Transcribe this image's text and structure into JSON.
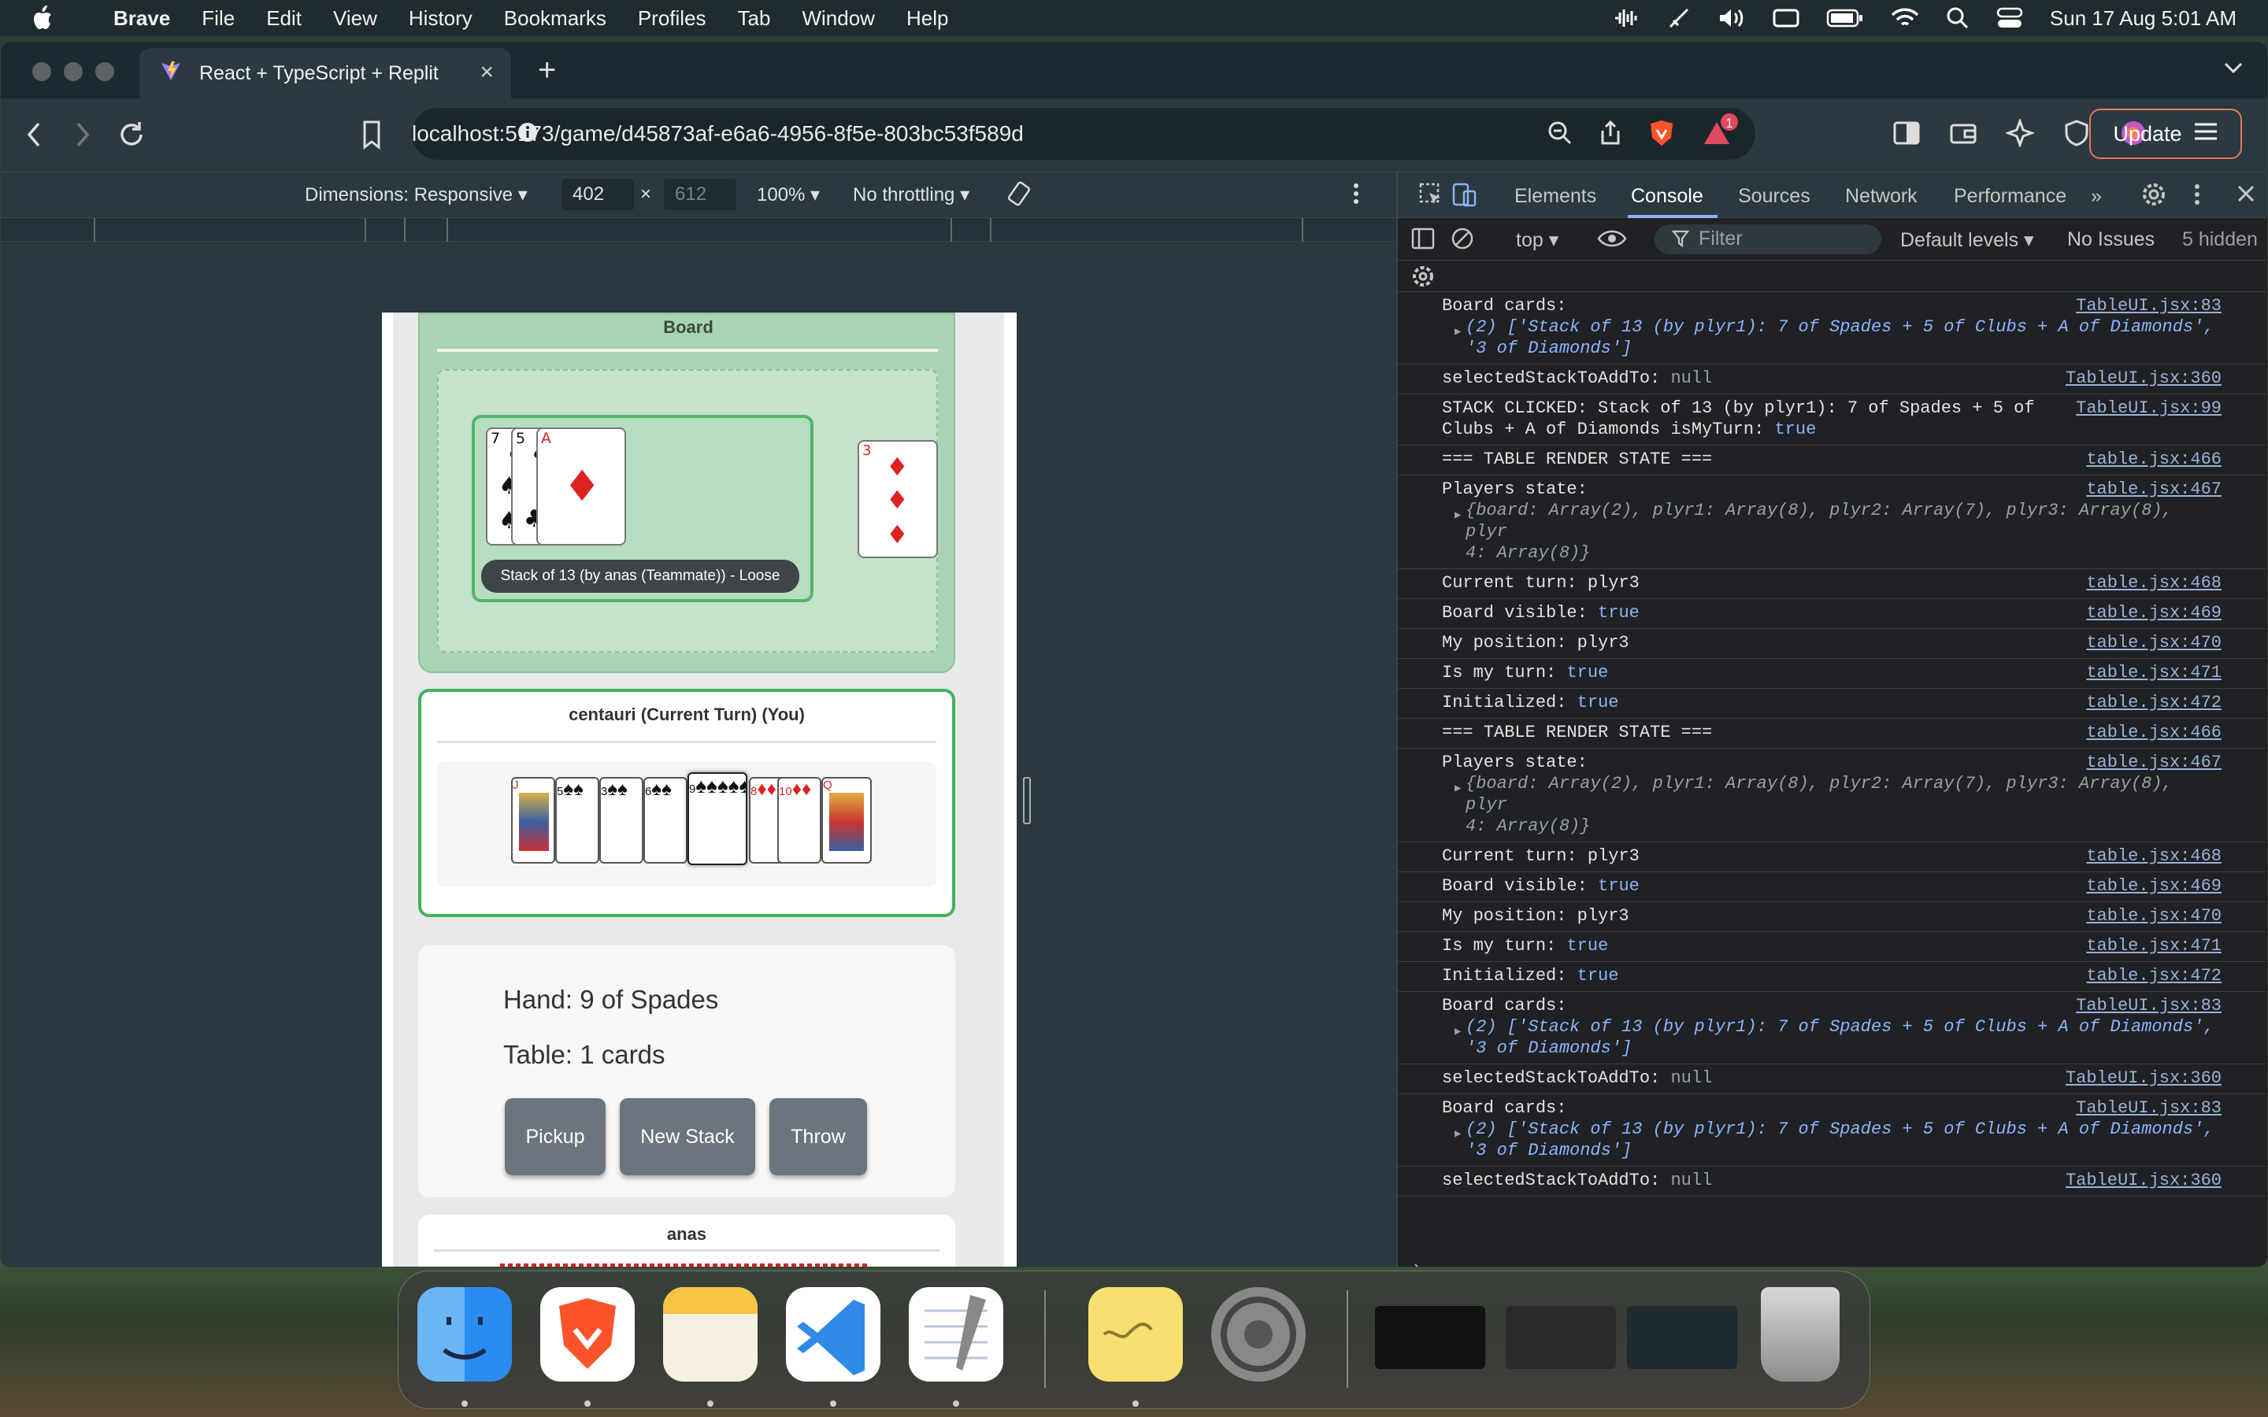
{
  "menubar": {
    "app": "Brave",
    "items": [
      "File",
      "Edit",
      "View",
      "History",
      "Bookmarks",
      "Profiles",
      "Tab",
      "Window",
      "Help"
    ],
    "datetime": "Sun 17 Aug  5:01 AM"
  },
  "browser": {
    "tab_title": "React + TypeScript + Replit",
    "url": "localhost:5173/game/d45873af-e6a6-4956-8f5e-803bc53f589d",
    "update_label": "Update",
    "notification_count": "1"
  },
  "device_toolbar": {
    "dimensions": "Dimensions: Responsive",
    "width": "402",
    "height": "612",
    "zoom": "100%",
    "throttling": "No throttling"
  },
  "game": {
    "board_title": "Board",
    "stack": {
      "cards": [
        {
          "rank": "7",
          "suit": "♠",
          "color": "black"
        },
        {
          "rank": "5",
          "suit": "♣",
          "color": "black"
        },
        {
          "rank": "A",
          "suit": "♦",
          "color": "red"
        }
      ],
      "label": "Stack of 13 (by anas (Teammate)) - Loose"
    },
    "loose_card": {
      "rank": "3",
      "suit": "♦",
      "color": "red"
    },
    "player_title": "centauri (Current Turn) (You)",
    "hand_cards": [
      {
        "rank": "J",
        "suit": "♣",
        "color": "black",
        "face": true
      },
      {
        "rank": "5",
        "suit": "♠",
        "color": "black"
      },
      {
        "rank": "3",
        "suit": "♠",
        "color": "black"
      },
      {
        "rank": "6",
        "suit": "♠",
        "color": "black"
      },
      {
        "rank": "9",
        "suit": "♠",
        "color": "black",
        "selected": true
      },
      {
        "rank": "8",
        "suit": "♦",
        "color": "red"
      },
      {
        "rank": "10",
        "suit": "♦",
        "color": "red"
      },
      {
        "rank": "Q",
        "suit": "♦",
        "color": "red",
        "face": true
      }
    ],
    "hand_info": "Hand: 9 of Spades",
    "table_info": "Table: 1 cards",
    "buttons": [
      "Pickup",
      "New Stack",
      "Throw"
    ],
    "next_player": "anas"
  },
  "devtools": {
    "tabs": [
      "Elements",
      "Console",
      "Sources",
      "Network",
      "Performance"
    ],
    "active_tab": "Console",
    "context": "top",
    "filter_placeholder": "Filter",
    "levels": "Default levels",
    "issues": "No Issues",
    "hidden": "5 hidden",
    "logs": [
      {
        "text": "Board cards:",
        "sub": "(2) ['Stack of 13 (by plyr1): 7 of Spades + 5 of Clubs + A of Diamonds',",
        "sub2": "'3 of Diamonds']",
        "src": "TableUI.jsx:83"
      },
      {
        "text": "selectedStackToAddTo:",
        "val": "null",
        "null": true,
        "src": "TableUI.jsx:360"
      },
      {
        "text": "STACK CLICKED: Stack of 13 (by plyr1): 7 of Spades + 5 of",
        "text2": "Clubs + A of Diamonds isMyTurn:",
        "val": "true",
        "src": "TableUI.jsx:99"
      },
      {
        "text": "=== TABLE RENDER STATE ===",
        "src": "table.jsx:466"
      },
      {
        "text": "Players state:",
        "sub": "{board: Array(2), plyr1: Array(8), plyr2: Array(7), plyr3: Array(8), plyr",
        "sub2": "4: Array(8)}",
        "src": "table.jsx:467"
      },
      {
        "text": "Current turn: plyr3",
        "src": "table.jsx:468"
      },
      {
        "text": "Board visible:",
        "val": "true",
        "src": "table.jsx:469"
      },
      {
        "text": "My position: plyr3",
        "src": "table.jsx:470"
      },
      {
        "text": "Is my turn:",
        "val": "true",
        "src": "table.jsx:471"
      },
      {
        "text": "Initialized:",
        "val": "true",
        "src": "table.jsx:472"
      },
      {
        "text": "=== TABLE RENDER STATE ===",
        "src": "table.jsx:466"
      },
      {
        "text": "Players state:",
        "sub": "{board: Array(2), plyr1: Array(8), plyr2: Array(7), plyr3: Array(8), plyr",
        "sub2": "4: Array(8)}",
        "src": "table.jsx:467"
      },
      {
        "text": "Current turn: plyr3",
        "src": "table.jsx:468"
      },
      {
        "text": "Board visible:",
        "val": "true",
        "src": "table.jsx:469"
      },
      {
        "text": "My position: plyr3",
        "src": "table.jsx:470"
      },
      {
        "text": "Is my turn:",
        "val": "true",
        "src": "table.jsx:471"
      },
      {
        "text": "Initialized:",
        "val": "true",
        "src": "table.jsx:472"
      },
      {
        "text": "Board cards:",
        "sub": "(2) ['Stack of 13 (by plyr1): 7 of Spades + 5 of Clubs + A of Diamonds',",
        "sub2": "'3 of Diamonds']",
        "src": "TableUI.jsx:83"
      },
      {
        "text": "selectedStackToAddTo:",
        "val": "null",
        "null": true,
        "src": "TableUI.jsx:360"
      },
      {
        "text": "Board cards:",
        "sub": "(2) ['Stack of 13 (by plyr1): 7 of Spades + 5 of Clubs + A of Diamonds',",
        "sub2": "'3 of Diamonds']",
        "src": "TableUI.jsx:83"
      },
      {
        "text": "selectedStackToAddTo:",
        "val": "null",
        "null": true,
        "src": "TableUI.jsx:360"
      }
    ]
  },
  "dock": {
    "apps": [
      "finder-icon",
      "brave-icon",
      "notes-icon",
      "vscode-icon",
      "textedit-icon",
      "stickies-icon",
      "settings-icon",
      "trash-icon"
    ]
  }
}
